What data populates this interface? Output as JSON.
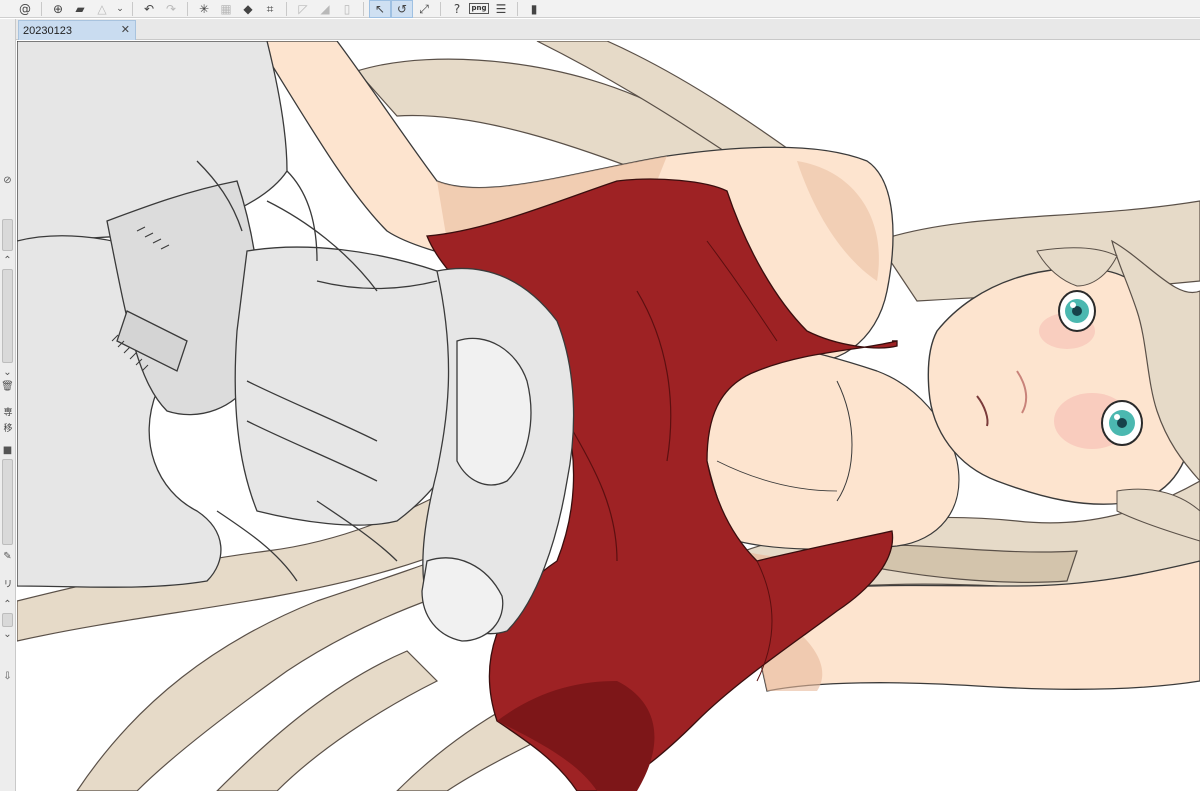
{
  "toolbar": {
    "icons": [
      "spiral-icon",
      "new-canvas-icon",
      "open-folder-icon",
      "warning-icon",
      "dropdown-icon",
      "undo-icon",
      "redo-icon",
      "clear-selection-icon",
      "invert-selection-icon",
      "fill-icon",
      "crop-icon",
      "gradient-icon",
      "shade-icon",
      "blank-icon",
      "snap-to-ruler-icon",
      "snap-to-special-ruler-icon",
      "rotate-icon",
      "help-icon",
      "export-png-icon",
      "layer-icon",
      "phone-icon"
    ],
    "png_label": "png"
  },
  "document": {
    "tab_title": "20230123",
    "close_glyph": "✕"
  },
  "left_strip": {
    "label_1": "専",
    "label_2": "移",
    "label_3": "リ"
  },
  "colors": {
    "top_red": "#9e2224",
    "top_red_shadow": "#7d1618",
    "skin": "#fde4cf",
    "skin_shadow": "#e8b99b",
    "hair": "#e6dac8",
    "hair_shadow": "#d3c4ac",
    "lineart_gray": "#e6e6e6",
    "outline": "#3a3a3a",
    "eye": "#4bb8b0"
  }
}
